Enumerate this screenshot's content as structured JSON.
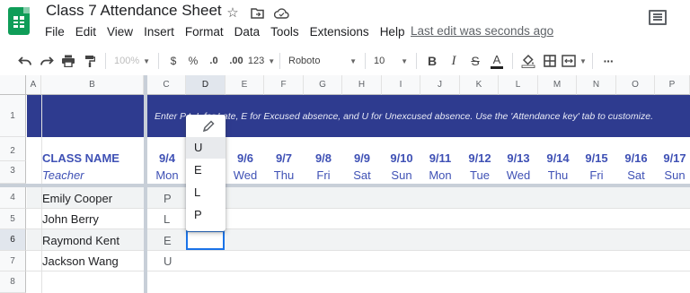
{
  "app": {
    "title": "Class 7 Attendance Sheet",
    "last_edit": "Last edit was seconds ago",
    "menu": [
      "File",
      "Edit",
      "View",
      "Insert",
      "Format",
      "Data",
      "Tools",
      "Extensions",
      "Help"
    ]
  },
  "toolbar": {
    "zoom": "100%",
    "currency": "$",
    "percent": "%",
    "dec_decrease": ".0",
    "dec_increase": ".00",
    "more_formats": "123",
    "font": "Roboto",
    "font_size": "10",
    "bold": "B",
    "italic": "I",
    "strike": "S",
    "text_color": "A",
    "more": "···"
  },
  "grid": {
    "columns": [
      "A",
      "B",
      "C",
      "D",
      "E",
      "F",
      "G",
      "H",
      "I",
      "J",
      "K",
      "L",
      "M",
      "N",
      "O",
      "P"
    ],
    "rows": [
      "1",
      "2",
      "3",
      "4",
      "5",
      "6",
      "7",
      "8"
    ],
    "selected_column": "D",
    "selected_row": "6",
    "banner_text": "Enter P                  t, L for Late, E for Excused absence, and U for Unexcused absence. Use the 'Attendance key' tab to customize.",
    "class_name_label": "CLASS NAME",
    "teacher_label": "Teacher",
    "dates": [
      "9/4",
      "9/6",
      "9/7",
      "9/8",
      "9/9",
      "9/10",
      "9/11",
      "9/12",
      "9/13",
      "9/14",
      "9/15",
      "9/16",
      "9/17"
    ],
    "days": [
      "Mon",
      "Wed",
      "Thu",
      "Fri",
      "Sat",
      "Sun",
      "Mon",
      "Tue",
      "Wed",
      "Thu",
      "Fri",
      "Sat",
      "Sun"
    ],
    "students": [
      {
        "name": "Emily Cooper",
        "status": "P"
      },
      {
        "name": "John Berry",
        "status": "L"
      },
      {
        "name": "Raymond Kent",
        "status": "E"
      },
      {
        "name": "Jackson Wang",
        "status": "U"
      }
    ]
  },
  "dropdown": {
    "options": [
      "U",
      "E",
      "L",
      "P"
    ],
    "highlighted": "U"
  },
  "colors": {
    "banner": "#2e3b8f",
    "accent_blue": "#3f51b5",
    "selection": "#1a73e8",
    "sheets_green": "#0f9d58"
  }
}
